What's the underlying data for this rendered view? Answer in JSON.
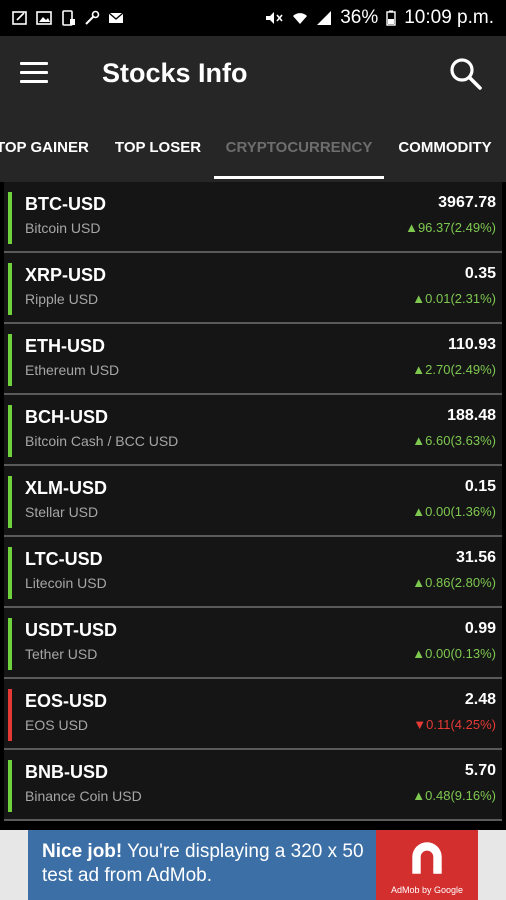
{
  "status_bar": {
    "battery": "36%",
    "time": "10:09 p.m."
  },
  "app_bar": {
    "title": "Stocks Info"
  },
  "tabs": [
    {
      "label": "TOP GAINER"
    },
    {
      "label": "TOP LOSER"
    },
    {
      "label": "CRYPTOCURRENCY",
      "active": true
    },
    {
      "label": "COMMODITY"
    }
  ],
  "colors": {
    "up": "#7ec850",
    "down": "#e53935",
    "up_bar": "#6fd13b",
    "down_bar": "#e53935"
  },
  "rows": [
    {
      "symbol": "BTC-USD",
      "name": "Bitcoin USD",
      "price": "3967.78",
      "change": "96.37(2.49%)",
      "direction": "up"
    },
    {
      "symbol": "XRP-USD",
      "name": "Ripple USD",
      "price": "0.35",
      "change": "0.01(2.31%)",
      "direction": "up"
    },
    {
      "symbol": "ETH-USD",
      "name": "Ethereum USD",
      "price": "110.93",
      "change": "2.70(2.49%)",
      "direction": "up"
    },
    {
      "symbol": "BCH-USD",
      "name": "Bitcoin Cash / BCC USD",
      "price": "188.48",
      "change": "6.60(3.63%)",
      "direction": "up"
    },
    {
      "symbol": "XLM-USD",
      "name": "Stellar USD",
      "price": "0.15",
      "change": "0.00(1.36%)",
      "direction": "up"
    },
    {
      "symbol": "LTC-USD",
      "name": "Litecoin USD",
      "price": "31.56",
      "change": "0.86(2.80%)",
      "direction": "up"
    },
    {
      "symbol": "USDT-USD",
      "name": "Tether USD",
      "price": "0.99",
      "change": "0.00(0.13%)",
      "direction": "up"
    },
    {
      "symbol": "EOS-USD",
      "name": "EOS USD",
      "price": "2.48",
      "change": "0.11(4.25%)",
      "direction": "down"
    },
    {
      "symbol": "BNB-USD",
      "name": "Binance Coin USD",
      "price": "5.70",
      "change": "0.48(9.16%)",
      "direction": "up"
    }
  ],
  "ad": {
    "headline": "Nice job!",
    "body": " You're displaying a 320 x 50 test ad from AdMob.",
    "logo_label": "AdMob by Google"
  }
}
